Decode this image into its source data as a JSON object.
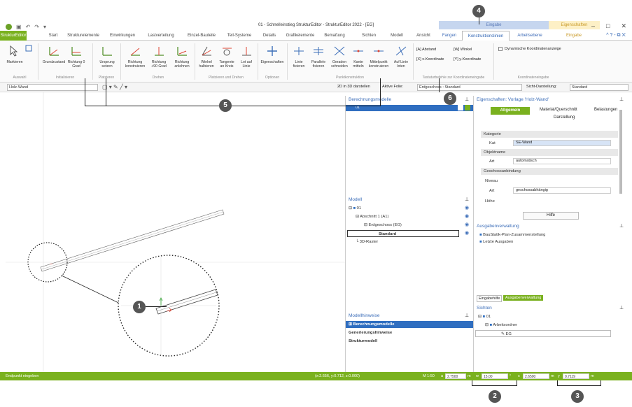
{
  "title": {
    "app_title": "01 - Schnelleinstieg StrukturEditor - StrukturEditor 2022 - [EG]",
    "context_group_eingabe": "Eingabe",
    "context_group_eigenschaften": "Eigenschaften"
  },
  "tabs": [
    "StrukturEditor",
    "Start",
    "Strukturelemente",
    "Einwirkungen",
    "Lastverteilung",
    "Einzel-Bauteile",
    "Teil-Systeme",
    "Details",
    "Grafikelemente",
    "Bemaßung",
    "Sichten",
    "Modell",
    "Ansicht",
    "Fangen",
    "Konstruktionslinien",
    "Arbeitsebene",
    "Eingabe"
  ],
  "ribbon": {
    "buttons": [
      {
        "label": "Markieren"
      },
      {
        "label": "Grundzustand"
      },
      {
        "label": "Richtung 0 Grad"
      },
      {
        "label": "Ursprung setzen"
      },
      {
        "label": "Richtung konstruieren"
      },
      {
        "label": "Richtung +90 Grad"
      },
      {
        "label": "Richtung anlehnen"
      },
      {
        "label": "Winkel halbieren"
      },
      {
        "label": "Tangente an Kreis"
      },
      {
        "label": "Lot auf Linie"
      },
      {
        "label": "Eigenschaften"
      },
      {
        "label": "Linie fixieren"
      },
      {
        "label": "Parallele fixieren"
      },
      {
        "label": "Geraden schneiden"
      },
      {
        "label": "Kante mitteln"
      },
      {
        "label": "Mittelpunkt konstruieren"
      },
      {
        "label": "Auf Linie loten"
      }
    ],
    "groups": [
      "Auswahl",
      "Initialisieren",
      "Platzieren",
      "Drehen",
      "Platzieren und Drehen",
      "Optionen",
      "Punktkonstruktion",
      "Tastaturbefehle zur Koordinateneingabe",
      "Koordinateneingabe"
    ],
    "kbd_shortcuts": [
      "[A] Abstand",
      "[W] Winkel",
      "[X] x-Koordinate",
      "[Y] y-Koordinate"
    ],
    "dynamic_label": "Dynamische Koordinatenanzeige"
  },
  "toolbar": {
    "vorlage": "Holz-Wand",
    "twod_label": "2D in 3D darstellen",
    "folie_label": "Aktive Folie:",
    "folie_value": "Erdgeschoss : Standard",
    "sicht_label": "Sicht-Darstellung:",
    "sicht_value": "Standard"
  },
  "berechnungsmodelle": {
    "title": "Berechnungsmodelle",
    "item": "01"
  },
  "modell": {
    "title": "Modell",
    "rows": [
      "01",
      "Abschnitt 1 (A1)",
      "Erdgeschoss (EG)",
      "Standard",
      "3D-Raster"
    ]
  },
  "hinweise": {
    "title": "Modellhinweise",
    "rows": [
      "Berechnungsmodelle",
      "Generierungshinweise",
      "Strukturmodell"
    ]
  },
  "properties": {
    "title": "Eigenschaften: Vorlage 'Holz-Wand'",
    "tabs": [
      "Allgemein",
      "Material/Querschnitt",
      "Belastungen",
      "Darstellung"
    ],
    "sec_kategorie": "Kategorie",
    "kat_label": "Kat",
    "kat_value": "SE-Wand",
    "sec_objektname": "Objektname",
    "art_label": "Art",
    "art_value": "automatisch",
    "sec_geschoss": "Geschossanbindung",
    "niveau_label": "Niveau",
    "art2_label": "Art",
    "art2_value": "geschossabhängig",
    "hoehe_label": "Höhe",
    "help": "Hilfe"
  },
  "ausgaben": {
    "title": "Ausgabenverwaltung",
    "rows": [
      "BauStatik-Plan-Zusammenstellung",
      "Letzte Ausgaben"
    ],
    "tabs": [
      "Eingabehilfe",
      "Ausgabenverwaltung"
    ]
  },
  "sichten": {
    "title": "Sichten",
    "rows": [
      "01",
      "Arbeitsordner",
      "EG"
    ]
  },
  "status": {
    "prompt": "Endpunkt eingeben",
    "coords": "(x:2.656, y:0.712, z:0.000)",
    "scale": "M 1:50",
    "a_label": "a",
    "a_value": "2.7500",
    "a_unit": "m",
    "w_label": "w",
    "w_value": "15.00",
    "w_unit": "°",
    "x_label": "x",
    "x_value": "2.6500",
    "x_unit": "m",
    "y_label": "y",
    "y_value": "0.7119",
    "y_unit": "m"
  },
  "callouts": [
    "1",
    "2",
    "3",
    "4",
    "5",
    "6"
  ]
}
